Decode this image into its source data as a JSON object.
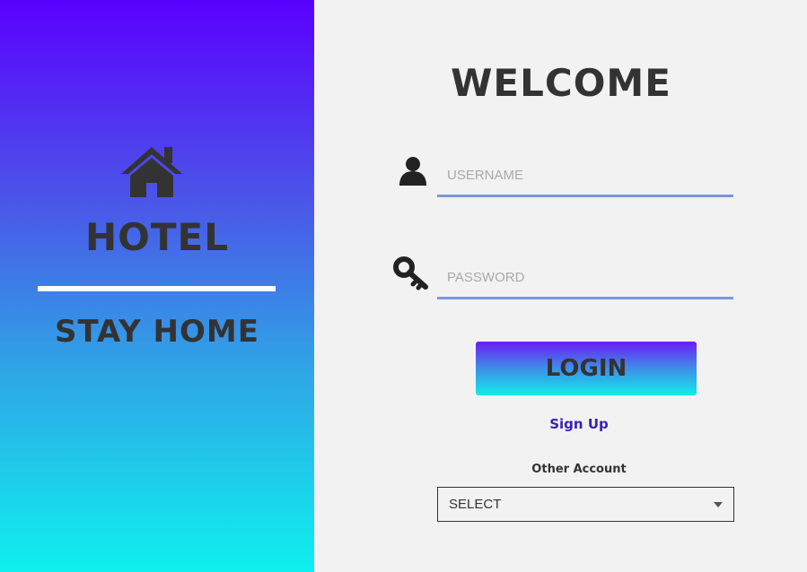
{
  "brand": {
    "icon": "home-icon",
    "title": "HOTEL",
    "tagline": "STAY HOME"
  },
  "login": {
    "heading": "WELCOME",
    "username": {
      "icon": "user-icon",
      "placeholder": "USERNAME",
      "value": ""
    },
    "password": {
      "icon": "key-icon",
      "placeholder": "PASSWORD",
      "value": ""
    },
    "submit_label": "LOGIN",
    "signup_label": "Sign Up",
    "other_account": {
      "label": "Other Account",
      "selected": "SELECT"
    }
  },
  "colors": {
    "gradient_top": "#5a00ff",
    "gradient_bottom": "#0ef0ee",
    "field_underline": "#7b98d9",
    "link": "#3a1fb7",
    "text_dark": "#333333",
    "background": "#f2f2f2"
  }
}
